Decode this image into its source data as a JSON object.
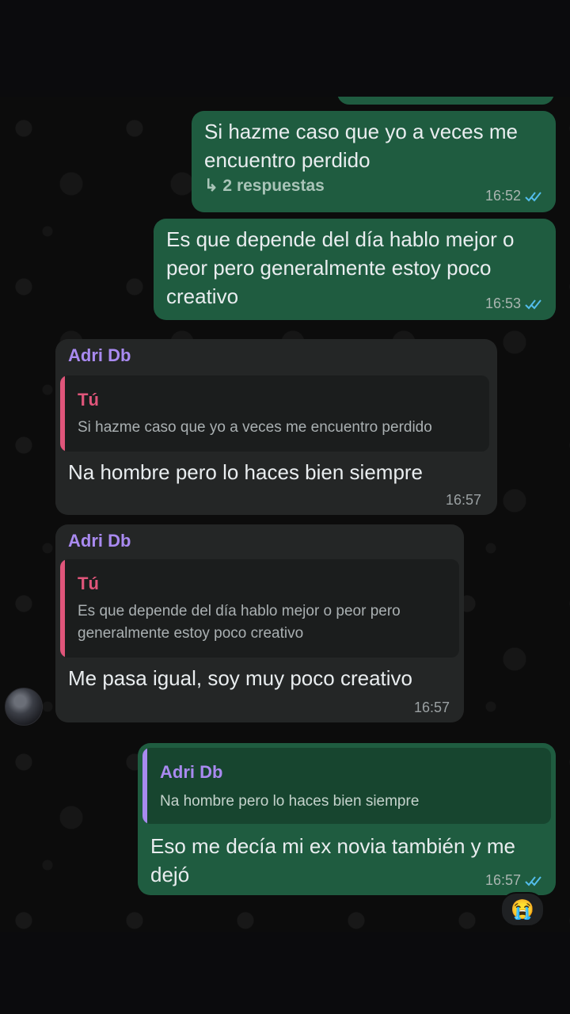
{
  "messages": [
    {
      "text": "Si hazme caso que yo a veces me encuentro perdido",
      "replies": "↳ 2 respuestas",
      "time": "16:52"
    },
    {
      "text": "Es que depende del día hablo mejor o peor pero generalmente estoy poco creativo",
      "time": "16:53"
    },
    {
      "sender": "Adri Db",
      "quote_name": "Tú",
      "quote_text": "Si hazme caso que yo a veces me encuentro perdido",
      "text": "Na hombre pero lo haces bien siempre",
      "time": "16:57"
    },
    {
      "sender": "Adri Db",
      "quote_name": "Tú",
      "quote_text": "Es que depende del día hablo mejor o peor pero generalmente estoy poco creativo",
      "text": "Me pasa igual, soy muy poco creativo",
      "time": "16:57"
    },
    {
      "quote_name": "Adri Db",
      "quote_text": "Na hombre pero lo haces bien siempre",
      "text": "Eso me decía mi ex novia también y me dejó",
      "time": "16:57",
      "reaction": "😭"
    }
  ],
  "colors": {
    "outgoing_bubble": "#1f5c40",
    "incoming_bubble": "#242626",
    "sender_name": "#a98af0",
    "quote_bar_you": "#e0557a",
    "quote_bar_other": "#a98af0",
    "read_ticks": "#53bdeb"
  }
}
